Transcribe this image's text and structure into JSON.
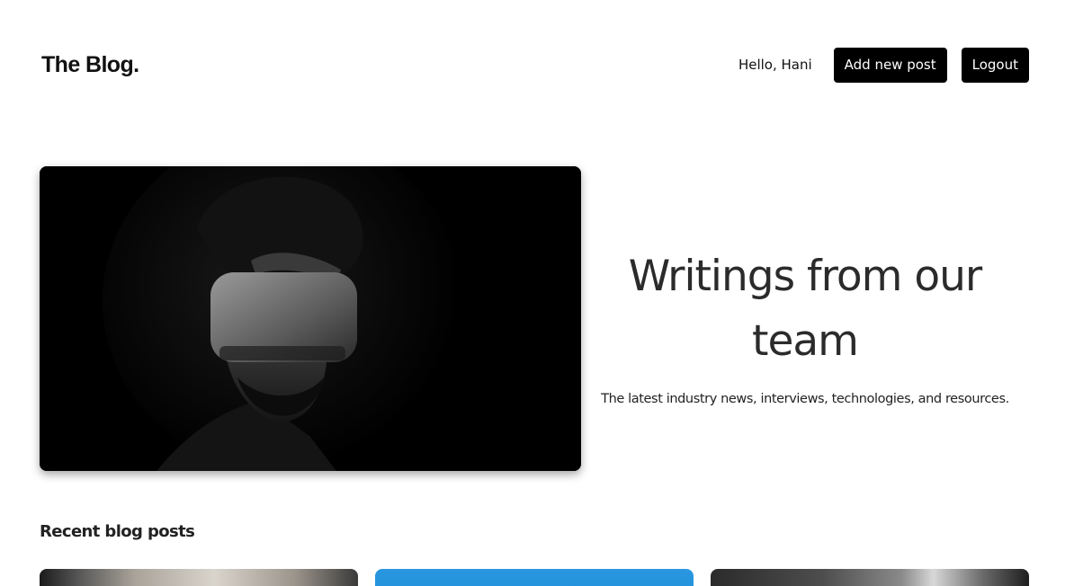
{
  "header": {
    "logo": "The Blog.",
    "greeting": "Hello, Hani",
    "add_post_label": "Add new post",
    "logout_label": "Logout"
  },
  "hero": {
    "title": "Writings from our team",
    "subtitle": "The latest industry news, interviews, technologies, and resources."
  },
  "recent": {
    "title": "Recent blog posts"
  },
  "colors": {
    "button_bg": "#000000",
    "button_text": "#ffffff",
    "card_2_accent": "#2a97e0"
  }
}
